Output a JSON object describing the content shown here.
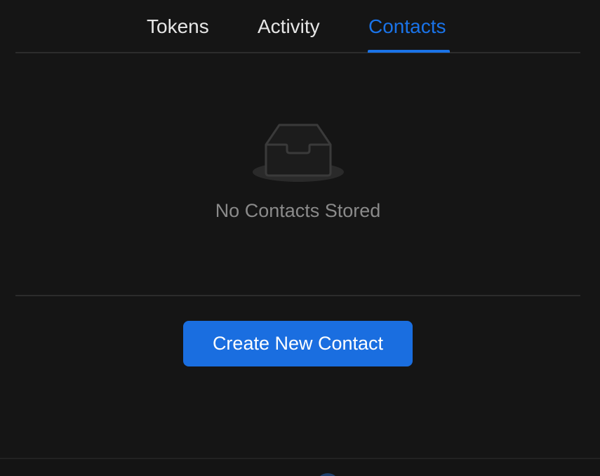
{
  "tabs": {
    "items": [
      {
        "label": "Tokens"
      },
      {
        "label": "Activity"
      },
      {
        "label": "Contacts"
      }
    ],
    "active": "Contacts"
  },
  "empty_state": {
    "icon": "inbox-icon",
    "message": "No Contacts Stored"
  },
  "actions": {
    "create_label": "Create New Contact"
  },
  "colors": {
    "background": "#151515",
    "accent": "#1a73e8",
    "button": "#1a6ee0",
    "muted_text": "#8a8a8a"
  }
}
